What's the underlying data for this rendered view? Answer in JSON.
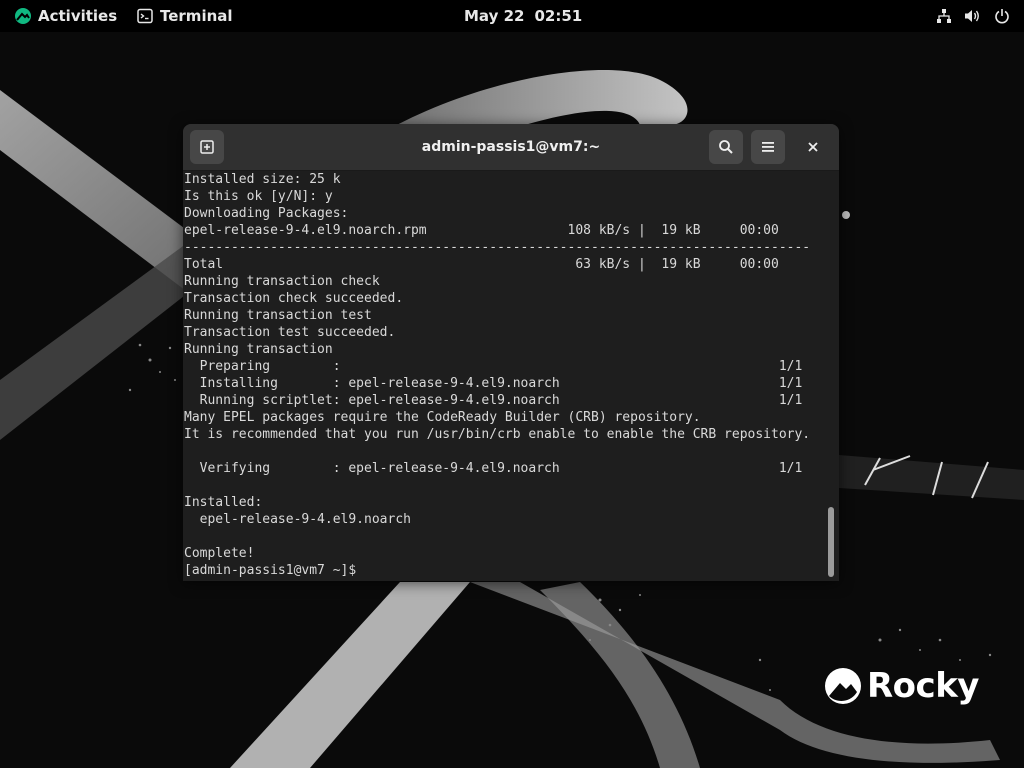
{
  "topbar": {
    "activities_label": "Activities",
    "app_menu_label": "Terminal",
    "clock_date": "May 22",
    "clock_time": "02:51",
    "tray_icons": [
      "network-icon",
      "volume-icon",
      "power-icon"
    ]
  },
  "window": {
    "title": "admin-passis1@vm7:~",
    "buttons": [
      "new-tab-icon",
      "search-icon",
      "menu-icon",
      "close-icon"
    ]
  },
  "terminal": {
    "lines": [
      "Installed size: 25 k",
      "Is this ok [y/N]: y",
      "Downloading Packages:",
      "epel-release-9-4.el9.noarch.rpm                  108 kB/s |  19 kB     00:00",
      "--------------------------------------------------------------------------------",
      "Total                                             63 kB/s |  19 kB     00:00",
      "Running transaction check",
      "Transaction check succeeded.",
      "Running transaction test",
      "Transaction test succeeded.",
      "Running transaction",
      "  Preparing        :                                                        1/1",
      "  Installing       : epel-release-9-4.el9.noarch                            1/1",
      "  Running scriptlet: epel-release-9-4.el9.noarch                            1/1",
      "Many EPEL packages require the CodeReady Builder (CRB) repository.",
      "It is recommended that you run /usr/bin/crb enable to enable the CRB repository.",
      "",
      "  Verifying        : epel-release-9-4.el9.noarch                            1/1",
      "",
      "Installed:",
      "  epel-release-9-4.el9.noarch",
      "",
      "Complete!",
      "[admin-passis1@vm7 ~]$ "
    ]
  },
  "desktop": {
    "logo_text": "Rocky"
  },
  "colors": {
    "topbar_bg": "#000000",
    "headerbar_bg": "#303030",
    "terminal_bg": "#1e1e1e",
    "terminal_fg": "#d9d9d9",
    "rocky_green": "#10b981"
  }
}
